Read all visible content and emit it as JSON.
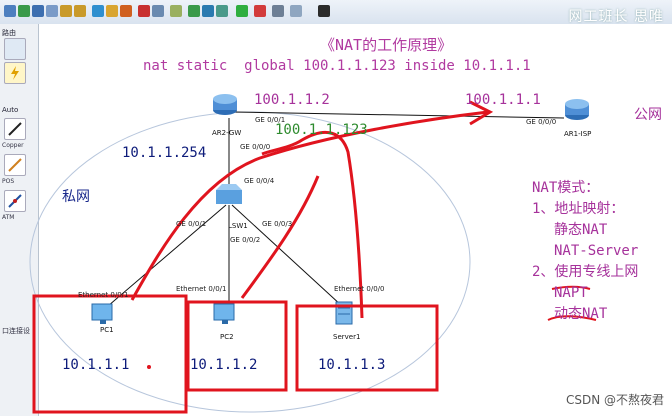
{
  "title": "《NAT的工作原理》",
  "command": "nat static  global 100.1.1.123 inside 10.1.1.1",
  "watermark_top": "网工班长 思唯",
  "left_panel": {
    "section1": "路由",
    "section2": "Auto",
    "links": [
      "Copper",
      "POS",
      "ATM"
    ],
    "connect_label": "口连接设"
  },
  "zones": {
    "private": "私网",
    "public": "公网"
  },
  "devices": {
    "router_gw": "AR2-GW",
    "router_isp": "AR1-ISP",
    "switch": "LSW1",
    "pc1": "PC1",
    "pc2": "PC2",
    "server1": "Server1"
  },
  "ports": {
    "gw_wan": "GE 0/0/1",
    "gw_lan": "GE 0/0/0",
    "isp": "GE 0/0/0",
    "sw_up": "GE 0/0/4",
    "sw_p1": "GE 0/0/1",
    "sw_p2": "GE 0/0/2",
    "sw_p3": "GE 0/0/3",
    "pc1_eth": "Ethernet 0/0/1",
    "pc2_eth": "Ethernet 0/0/1",
    "srv_eth": "Ethernet 0/0/0"
  },
  "ips": {
    "gw_public": "100.1.1.2",
    "isp_public": "100.1.1.1",
    "nat_global": "100.1.1.123",
    "gw_private": "10.1.1.254",
    "pc1": "10.1.1.1",
    "pc2": "10.1.1.2",
    "server1": "10.1.1.3"
  },
  "notes": {
    "heading": "NAT模式：",
    "item1": "1、地址映射：",
    "item1a": "静态NAT",
    "item1b": "NAT-Server",
    "item2": "2、使用专线上网",
    "item2a": "NAPT",
    "item2b": "动态NAT"
  },
  "csdn": "CSDN @不熬夜君",
  "colors": {
    "annotation_red": "#e0141e",
    "text_purple": "#a6329b",
    "text_navy": "#0d1b7a",
    "text_green": "#2e8b2e"
  }
}
